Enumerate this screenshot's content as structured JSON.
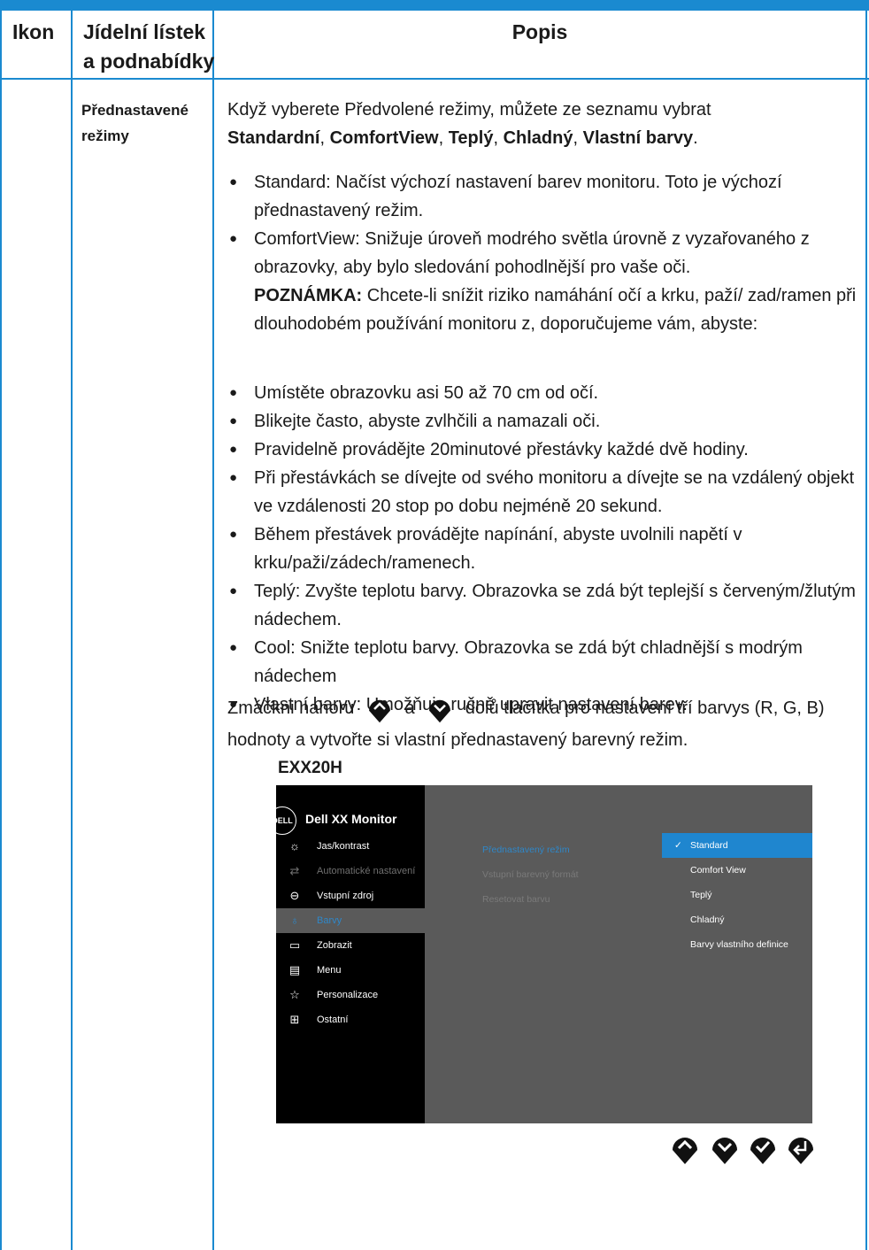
{
  "table": {
    "headers": {
      "icon": "Ikon",
      "menu_line1": "Jídelní lístek",
      "menu_line2": "a podnabídky",
      "description": "Popis"
    },
    "row": {
      "menu_line1": "Přednastavené",
      "menu_line2": "režimy",
      "intro": "Když vyberete Předvolené režimy, můžete ze seznamu vybrat",
      "intro_options": [
        "Standardní",
        "ComfortView",
        "Teplý",
        "Chladný",
        "Vlastní barvy"
      ],
      "bullets_top": [
        "Standard: Načíst výchozí nastavení barev monitoru. Toto je výchozí přednastavený režim.",
        "ComfortView: Snižuje úroveň modrého světla úrovně z vyzařovaného z obrazovky, aby bylo sledování pohodlnější pro vaše oči."
      ],
      "note_label": "POZNÁMKA:",
      "note_text": "Chcete-li snížit riziko namáhání očí a krku, paží/ zad/ramen při dlouhodobém používání monitoru z, doporučujeme vám, abyste:",
      "bullets_bottom": [
        "Umístěte obrazovku asi 50 až 70 cm od očí.",
        "Blikejte často, abyste zvlhčili a namazali oči.",
        "Pravidelně provádějte 20minutové přestávky každé dvě hodiny.",
        "Při přestávkách se dívejte od svého monitoru a dívejte se na vzdálený objekt ve vzdálenosti 20 stop po dobu nejméně 20 sekund.",
        "Během přestávek provádějte napínání, abyste uvolnili napětí v krku/paži/zádech/ramenech.",
        "Teplý: Zvyšte teplotu barvy. Obrazovka se zdá být teplejší s červeným/žlutým nádechem.",
        "Cool: Snižte teplotu barvy. Obrazovka se zdá být chladnější s modrým nádechem",
        "Vlastní barvy: Umožňuje ručně upravit nastavení barev."
      ],
      "press_part1": "Zmáčkni nahoru",
      "press_part2": "a",
      "press_part3": "dolů tlačítka pro nastavení tří barvys (R, G, B) hodnoty a vytvořte si vlastní přednastavený barevný režim."
    }
  },
  "osd": {
    "model": "EXX20H",
    "logo": "DELL",
    "title": "Dell XX Monitor",
    "menu": [
      {
        "icon": "brightness-icon",
        "glyph": "☼",
        "label": "Jas/kontrast",
        "state": "normal"
      },
      {
        "icon": "auto-adjust-icon",
        "glyph": "⇄",
        "label": "Automatické nastavení",
        "state": "dim"
      },
      {
        "icon": "input-source-icon",
        "glyph": "⊖",
        "label": "Vstupní zdroj",
        "state": "normal"
      },
      {
        "icon": "color-icon",
        "glyph": "♁",
        "label": "Barvy",
        "state": "selected"
      },
      {
        "icon": "display-icon",
        "glyph": "▭",
        "label": "Zobrazit",
        "state": "normal"
      },
      {
        "icon": "menu-icon",
        "glyph": "▤",
        "label": "Menu",
        "state": "normal"
      },
      {
        "icon": "star-icon",
        "glyph": "☆",
        "label": "Personalizace",
        "state": "normal"
      },
      {
        "icon": "others-icon",
        "glyph": "⊞",
        "label": "Ostatní",
        "state": "normal"
      }
    ],
    "submenu": [
      {
        "label": "Přednastavený režim",
        "state": "selected"
      },
      {
        "label": "Vstupní barevný formát",
        "state": "dim"
      },
      {
        "label": "Resetovat barvu",
        "state": "dim"
      }
    ],
    "options": [
      {
        "label": "Standard",
        "selected": true,
        "check": "✓"
      },
      {
        "label": "Comfort View",
        "selected": false,
        "check": ""
      },
      {
        "label": "Teplý",
        "selected": false,
        "check": ""
      },
      {
        "label": "Chladný",
        "selected": false,
        "check": ""
      },
      {
        "label": "Barvy vlastního definice",
        "selected": false,
        "check": ""
      }
    ],
    "buttons": [
      {
        "name": "up-button",
        "icon": "chevron-up-icon"
      },
      {
        "name": "down-button",
        "icon": "chevron-down-icon"
      },
      {
        "name": "ok-button",
        "icon": "check-icon"
      },
      {
        "name": "back-button",
        "icon": "back-icon"
      }
    ]
  }
}
